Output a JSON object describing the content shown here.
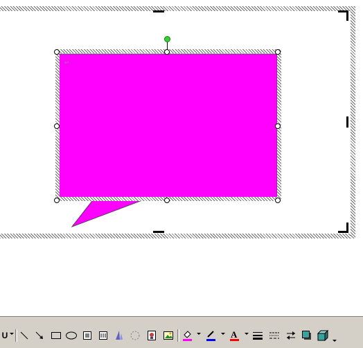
{
  "canvas": {
    "paragraph_mark": "↵",
    "callout_fill": "#ff00ff",
    "callout_stroke": "#5a3a6a"
  },
  "toolbar": {
    "items": [
      {
        "name": "autoshapes-menu",
        "icon": "autoshapes-icon",
        "label": "U"
      },
      {
        "name": "line-tool",
        "icon": "line-icon"
      },
      {
        "name": "arrow-tool",
        "icon": "arrow-icon"
      },
      {
        "name": "rectangle-tool",
        "icon": "rectangle-icon"
      },
      {
        "name": "oval-tool",
        "icon": "oval-icon"
      },
      {
        "name": "text-box-tool",
        "icon": "text-box-icon"
      },
      {
        "name": "vertical-text-box-tool",
        "icon": "vertical-text-box-icon"
      },
      {
        "name": "wordart-tool",
        "icon": "wordart-icon"
      },
      {
        "name": "diagram-tool",
        "icon": "diagram-icon"
      },
      {
        "name": "clip-art-tool",
        "icon": "clip-art-icon"
      },
      {
        "name": "picture-tool",
        "icon": "picture-icon"
      },
      {
        "name": "fill-color-button",
        "icon": "fill-bucket-icon",
        "color": "#ff00ff"
      },
      {
        "name": "line-color-button",
        "icon": "pen-icon",
        "color": "#0000ff"
      },
      {
        "name": "font-color-button",
        "icon": "font-a-icon",
        "label": "A",
        "color": "#ff0000"
      },
      {
        "name": "line-style-button",
        "icon": "line-style-icon"
      },
      {
        "name": "dash-style-button",
        "icon": "dash-style-icon"
      },
      {
        "name": "arrow-style-button",
        "icon": "arrow-style-icon"
      },
      {
        "name": "shadow-style-button",
        "icon": "shadow-icon"
      },
      {
        "name": "3d-style-button",
        "icon": "3d-icon"
      }
    ]
  }
}
